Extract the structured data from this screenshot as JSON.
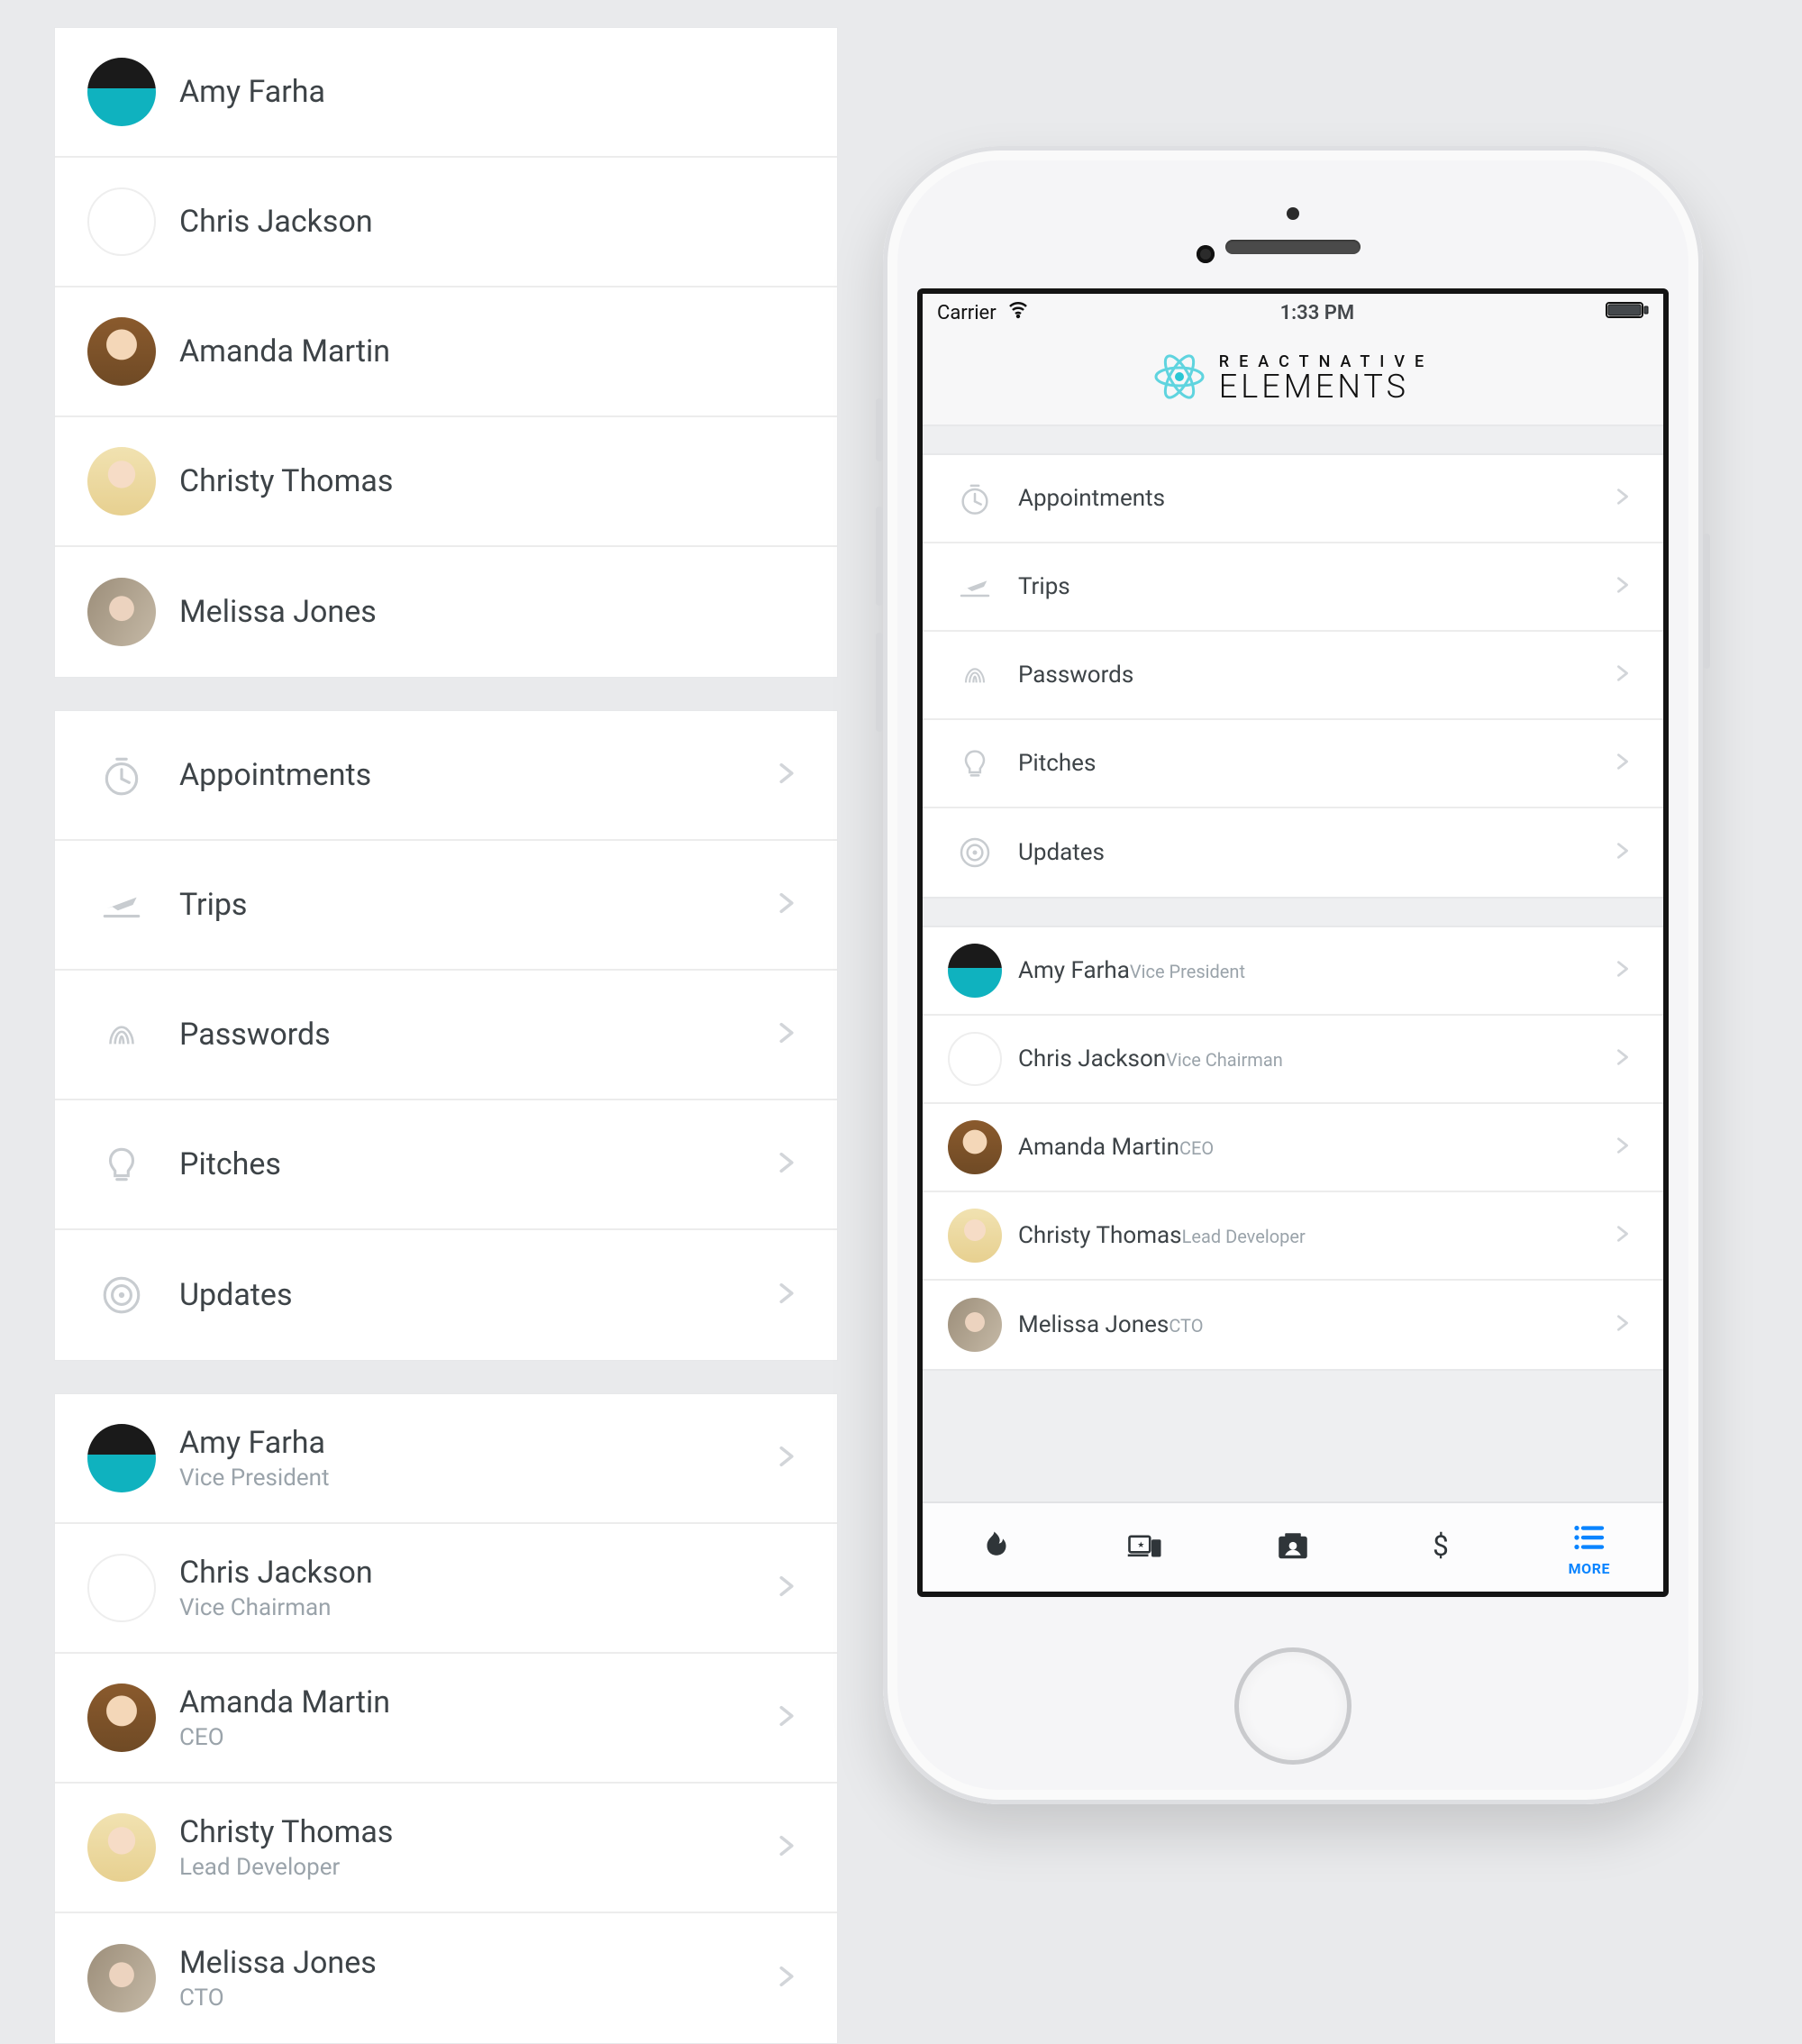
{
  "statusbar": {
    "carrier": "Carrier",
    "time": "1:33 PM"
  },
  "appheader": {
    "title_small": "REACTNATIVE",
    "title_big": "ELEMENTS"
  },
  "people_simple": [
    {
      "name": "Amy Farha",
      "avatar": "av1"
    },
    {
      "name": "Chris Jackson",
      "avatar": "av2"
    },
    {
      "name": "Amanda Martin",
      "avatar": "av3"
    },
    {
      "name": "Christy Thomas",
      "avatar": "av4"
    },
    {
      "name": "Melissa Jones",
      "avatar": "av5"
    }
  ],
  "menu_items": [
    {
      "label": "Appointments",
      "icon": "timer-icon"
    },
    {
      "label": "Trips",
      "icon": "flight-takeoff-icon"
    },
    {
      "label": "Passwords",
      "icon": "fingerprint-icon"
    },
    {
      "label": "Pitches",
      "icon": "lightbulb-icon"
    },
    {
      "label": "Updates",
      "icon": "track-changes-icon"
    }
  ],
  "people_detailed": [
    {
      "name": "Amy Farha",
      "role": "Vice President",
      "avatar": "av1"
    },
    {
      "name": "Chris Jackson",
      "role": "Vice Chairman",
      "avatar": "av2"
    },
    {
      "name": "Amanda Martin",
      "role": "CEO",
      "avatar": "av3"
    },
    {
      "name": "Christy Thomas",
      "role": "Lead Developer",
      "avatar": "av4"
    },
    {
      "name": "Melissa Jones",
      "role": "CTO",
      "avatar": "av5"
    }
  ],
  "tabs": {
    "more_label": "MORE"
  }
}
